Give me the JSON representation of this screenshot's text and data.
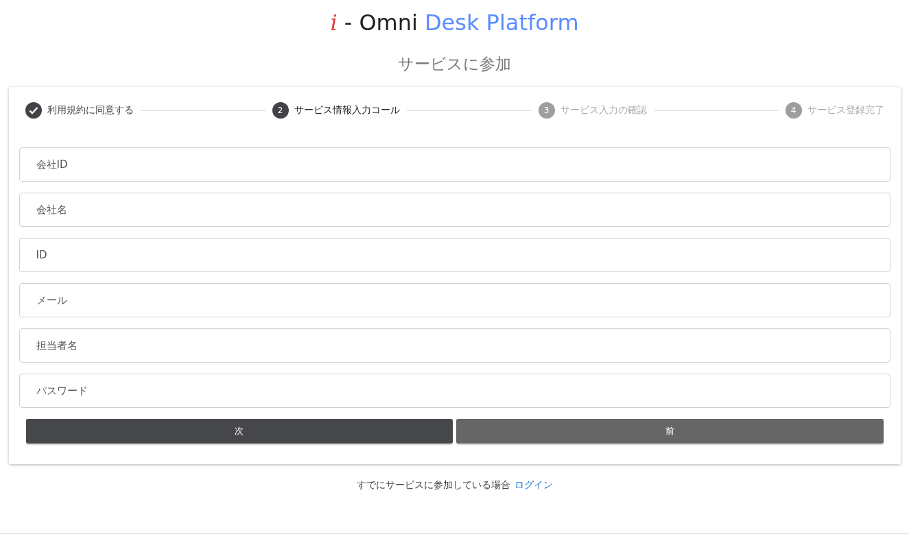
{
  "title": {
    "mark": "i",
    "main": "- Omni",
    "accent": "Desk Platform"
  },
  "subtitle": "サービスに参加",
  "steps": [
    {
      "label": "利用規約に同意する",
      "complete": true,
      "selected": false
    },
    {
      "number": "2",
      "label": "サービス情報入力コール",
      "complete": false,
      "selected": true
    },
    {
      "number": "3",
      "label": "サービス入力の確認",
      "complete": false,
      "selected": false
    },
    {
      "number": "4",
      "label": "サービス登録完了",
      "complete": false,
      "selected": false
    }
  ],
  "fields": [
    {
      "placeholder": "会社ID"
    },
    {
      "placeholder": "会社名"
    },
    {
      "placeholder": "ID"
    },
    {
      "placeholder": "メール"
    },
    {
      "placeholder": "担当者名"
    },
    {
      "placeholder": "パスワード"
    }
  ],
  "buttons": [
    {
      "label": "次",
      "kind": "primary"
    },
    {
      "label": "前",
      "kind": "secondary"
    }
  ],
  "footer": {
    "text": "すでにサービスに参加している場合",
    "link": "ログイン"
  }
}
